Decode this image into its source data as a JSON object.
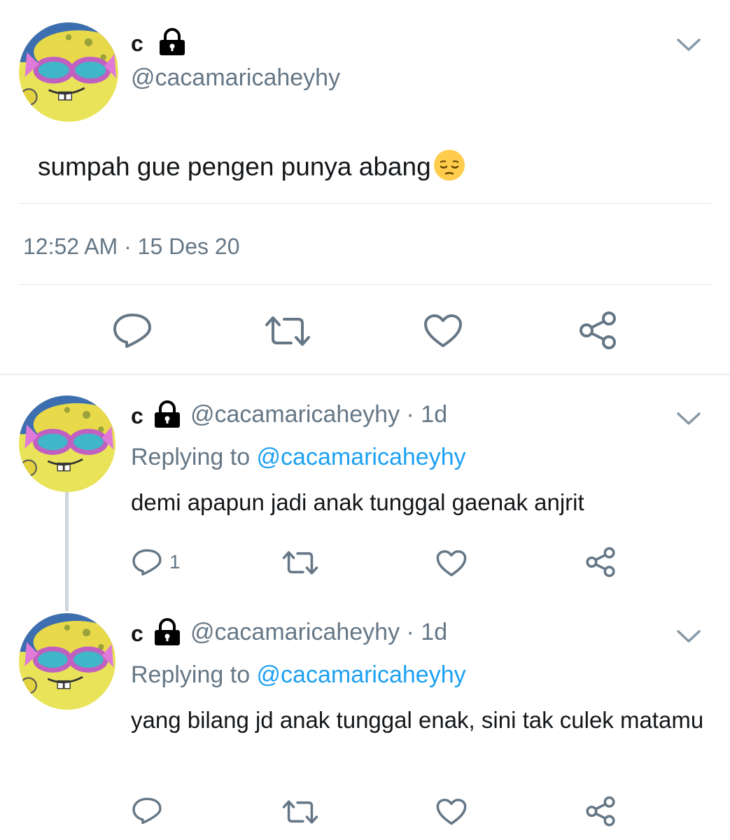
{
  "main_tweet": {
    "display_name": "c",
    "handle": "@cacamaricaheyhy",
    "text": "sumpah gue pengen punya abang",
    "emoji": "pensive-face",
    "timestamp": "12:52 AM · 15 Des 20"
  },
  "replies": [
    {
      "display_name": "c",
      "handle_time": "@cacamaricaheyhy · 1d",
      "replying_prefix": "Replying to ",
      "replying_handle": "@cacamaricaheyhy",
      "text": "demi apapun jadi anak tunggal gaenak anjrit",
      "reply_count": "1"
    },
    {
      "display_name": "c",
      "handle_time": "@cacamaricaheyhy · 1d",
      "replying_prefix": "Replying to ",
      "replying_handle": "@cacamaricaheyhy",
      "text": "yang bilang jd anak tunggal enak, sini tak culek matamu",
      "reply_count": ""
    }
  ],
  "icons": {
    "reply": "reply-icon",
    "retweet": "retweet-icon",
    "like": "heart-icon",
    "share": "share-icon",
    "menu": "chevron-down-icon",
    "protected": "lock-icon"
  },
  "colors": {
    "link": "#1da1f2",
    "secondary_text": "#657786",
    "icon": "#657786",
    "divider": "#e1e8ed"
  }
}
